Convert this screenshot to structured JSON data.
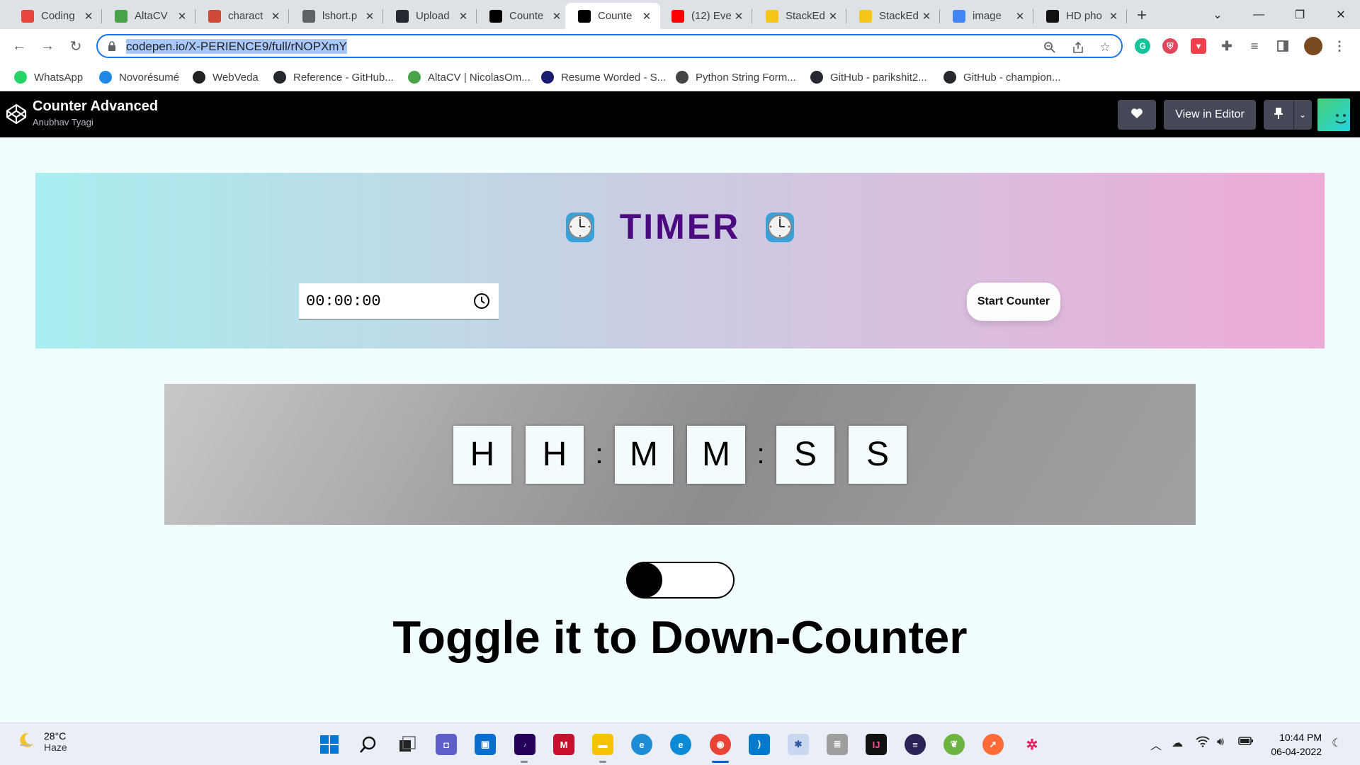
{
  "browser": {
    "tabs": [
      {
        "title": "Coding",
        "icon": "coding-favicon",
        "color": "#e8453c"
      },
      {
        "title": "AltaCV",
        "icon": "altacv-leaf-favicon",
        "color": "#47a248"
      },
      {
        "title": "charact",
        "icon": "braces-favicon",
        "color": "#d14836"
      },
      {
        "title": "lshort.p",
        "icon": "globe-favicon",
        "color": "#5f6368"
      },
      {
        "title": "Upload",
        "icon": "github-favicon",
        "color": "#24292f"
      },
      {
        "title": "Counte",
        "icon": "codepen-favicon",
        "color": "#000000"
      },
      {
        "title": "Counte",
        "icon": "codepen-favicon",
        "color": "#000000",
        "active": true
      },
      {
        "title": "(12) Eve",
        "icon": "youtube-favicon",
        "color": "#ff0000"
      },
      {
        "title": "StackEd",
        "icon": "stackedit-favicon",
        "color": "#f5c518"
      },
      {
        "title": "StackEd",
        "icon": "stackedit-favicon",
        "color": "#f5c518"
      },
      {
        "title": "image",
        "icon": "google-favicon",
        "color": "#4285f4"
      },
      {
        "title": "HD pho",
        "icon": "unsplash-favicon",
        "color": "#111111"
      }
    ],
    "new_tab_glyph": "+",
    "url": "codepen.io/X-PERIENCE9/full/rNOPXmY",
    "bookmarks": [
      {
        "label": "WhatsApp",
        "icon": "whatsapp-icon",
        "color": "#25d366"
      },
      {
        "label": "Novorésumé",
        "icon": "novoresume-icon",
        "color": "#1e88e5"
      },
      {
        "label": "WebVeda",
        "icon": "webveda-icon",
        "color": "#222222"
      },
      {
        "label": "Reference - GitHub...",
        "icon": "github-icon",
        "color": "#24292f"
      },
      {
        "label": "AltaCV | NicolasOm...",
        "icon": "altacv-icon",
        "color": "#47a248"
      },
      {
        "label": "Resume Worded - S...",
        "icon": "resume-worded-icon",
        "color": "#1a1a6e"
      },
      {
        "label": "Python String Form...",
        "icon": "tpg-icon",
        "color": "#444444"
      },
      {
        "label": "GitHub - parikshit2...",
        "icon": "github-icon",
        "color": "#24292f"
      },
      {
        "label": "GitHub - champion...",
        "icon": "github-icon",
        "color": "#24292f"
      }
    ]
  },
  "codepen": {
    "title": "Counter Advanced",
    "author": "Anubhav Tyagi",
    "view_in_editor": "View in Editor"
  },
  "page": {
    "timer_title": "TIMER",
    "time_value": "00:00:00",
    "start_button": "Start Counter",
    "digits": [
      "H",
      "H",
      "M",
      "M",
      "S",
      "S"
    ],
    "colon": ":",
    "toggle_label": "Toggle it to Down-Counter",
    "toggle_on": false
  },
  "taskbar": {
    "temperature": "28°C",
    "condition": "Haze",
    "time": "10:44 PM",
    "date": "06-04-2022"
  }
}
